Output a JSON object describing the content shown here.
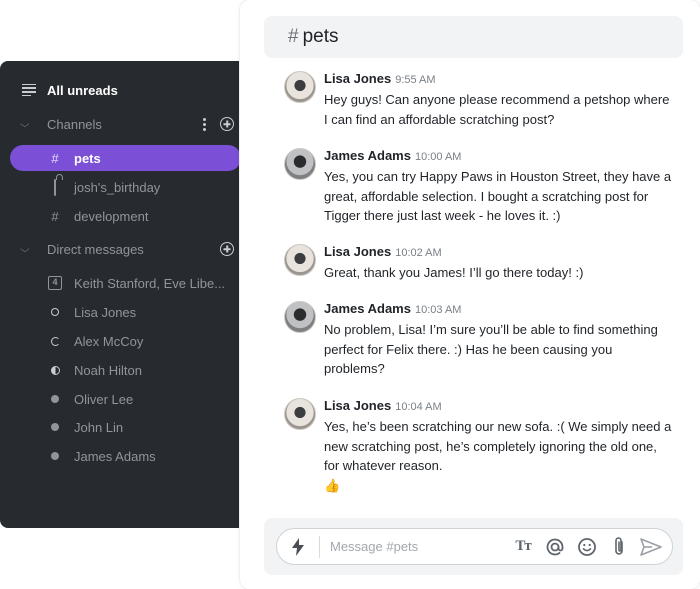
{
  "sidebar": {
    "all_unreads": "All unreads",
    "channels_label": "Channels",
    "channels": [
      {
        "label": "pets",
        "icon": "hash-icon",
        "active": true
      },
      {
        "label": "josh's_birthday",
        "icon": "lock-icon",
        "active": false
      },
      {
        "label": "development",
        "icon": "hash-icon",
        "active": false
      }
    ],
    "dm_label": "Direct messages",
    "direct_messages": [
      {
        "label": "Keith Stanford, Eve Libe...",
        "icon": "group-4-icon",
        "status": "group"
      },
      {
        "label": "Lisa Jones",
        "icon": "status-online-ring-icon",
        "status": "online"
      },
      {
        "label": "Alex McCoy",
        "icon": "status-away-icon",
        "status": "away"
      },
      {
        "label": "Noah Hilton",
        "icon": "status-busy-icon",
        "status": "busy"
      },
      {
        "label": "Oliver Lee",
        "icon": "status-offline-icon",
        "status": "offline"
      },
      {
        "label": "John Lin",
        "icon": "status-offline-icon",
        "status": "offline"
      },
      {
        "label": "James Adams",
        "icon": "status-offline-icon",
        "status": "offline"
      }
    ]
  },
  "chat": {
    "channel_hash": "#",
    "channel_name": "pets",
    "messages": [
      {
        "author": "Lisa Jones",
        "time": "9:55 AM",
        "lines": [
          "Hey guys! Can anyone please recommend a petshop where",
          "I can find an affordable scratching post?"
        ],
        "avatar": "lisa"
      },
      {
        "author": "James Adams",
        "time": "10:00 AM",
        "lines": [
          "Yes, you can try Happy Paws in Houston Street, they have a",
          "great, affordable selection. I bought a scratching post for",
          "Tigger there just last week - he loves it. :)"
        ],
        "avatar": "james"
      },
      {
        "author": "Lisa Jones",
        "time": "10:02 AM",
        "lines": [
          "Great, thank you James! I’ll go there today! :)"
        ],
        "avatar": "lisa"
      },
      {
        "author": "James Adams",
        "time": "10:03 AM",
        "lines": [
          "No problem, Lisa! I’m sure you’ll be able to find something",
          "perfect for Felix there. :) Has he been causing you",
          "problems?"
        ],
        "avatar": "james"
      },
      {
        "author": "Lisa Jones",
        "time": "10:04 AM",
        "lines": [
          "Yes, he’s been scratching our new sofa. :( We simply need a",
          "new scratching post, he’s completely ignoring the old one,",
          "for whatever reason."
        ],
        "avatar": "lisa",
        "reaction": "👍"
      }
    ],
    "composer": {
      "placeholder": "Message #pets",
      "tools": [
        "text-format-icon",
        "mention-icon",
        "emoji-icon",
        "attach-icon",
        "send-icon"
      ],
      "tt_label": "Tт"
    }
  },
  "colors": {
    "sidebar_bg": "#272b30",
    "accent": "#7b4fd6",
    "header_bg": "#f1f3f5"
  }
}
